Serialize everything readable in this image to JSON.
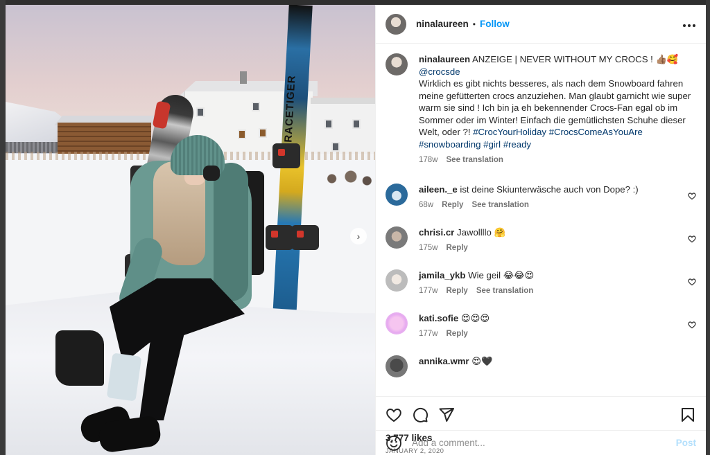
{
  "header": {
    "username": "ninalaureen",
    "separator": "•",
    "follow_label": "Follow",
    "more_icon": "more-horizontal-icon"
  },
  "photo": {
    "ski_brand": "RACETIGER",
    "next_icon": "chevron-right-icon"
  },
  "caption": {
    "username": "ninalaureen",
    "text_start": "ANZEIGE | NEVER WITHOUT MY CROCS ! 👍🏽🥰",
    "mention": "@crocsde",
    "text_body": "Wirklich es gibt nichts besseres, als nach dem Snowboard fahren meine gefütterten crocs anzuziehen. Man glaubt garnicht wie super warm sie sind ! Ich bin ja eh bekennender Crocs-Fan egal ob im Sommer oder im Winter! Einfach die gemütlichsten Schuhe dieser Welt, oder ?!",
    "hashtag1": "#CrocYourHoliday",
    "hashtags_rest": "#CrocsComeAsYouAre #snowboarding #girl #ready",
    "time": "178w",
    "see_translation": "See translation"
  },
  "comments": [
    {
      "username": "aileen._e",
      "text": "ist deine Skiunterwäsche auch von Dope? :)",
      "time": "68w",
      "reply": "Reply",
      "translate": "See translation"
    },
    {
      "username": "chrisi.cr",
      "text": "Jawollllo 🤗",
      "time": "175w",
      "reply": "Reply"
    },
    {
      "username": "jamila_ykb",
      "text": "Wie geil 😂😂😍",
      "time": "177w",
      "reply": "Reply",
      "translate": "See translation"
    },
    {
      "username": "kati.sofie",
      "text": "😍😍😍",
      "time": "177w",
      "reply": "Reply"
    },
    {
      "username": "annika.wmr",
      "text": "😍🖤"
    }
  ],
  "actions": {
    "likes": "3,777 likes",
    "date": "JANUARY 2, 2020"
  },
  "add_comment": {
    "placeholder": "Add a comment...",
    "post_label": "Post"
  }
}
